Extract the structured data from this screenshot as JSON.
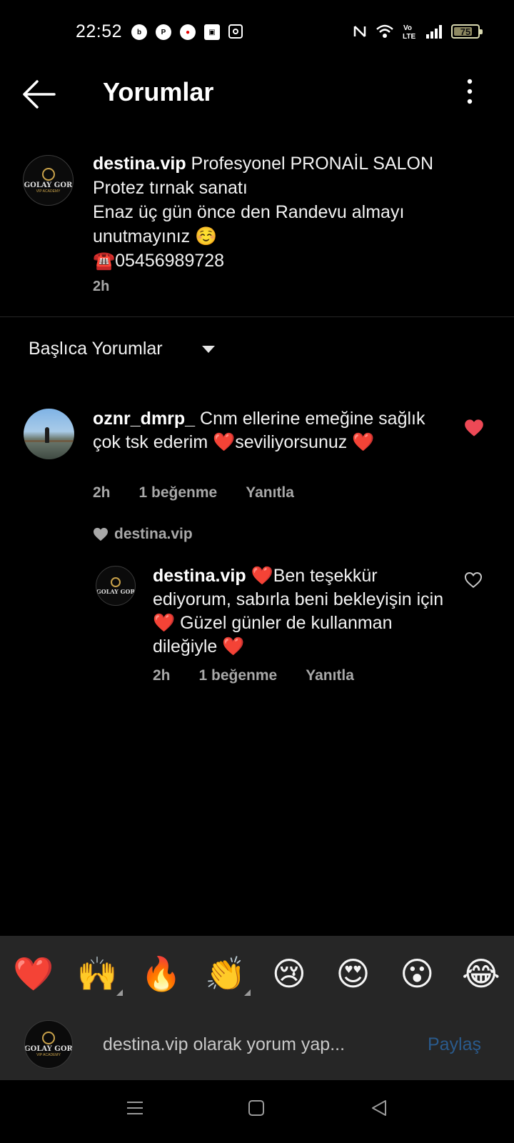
{
  "status_bar": {
    "time": "22:52",
    "app_icons": [
      "bip-icon",
      "pinterest-icon",
      "vodafone-icon",
      "box-icon",
      "instagram-icon"
    ],
    "battery": "75"
  },
  "header": {
    "title": "Yorumlar"
  },
  "caption": {
    "username": "destina.vip",
    "avatar_text": "GOLAY GOR",
    "avatar_subtext": "VIP ACADEMY",
    "line1": "Profesyonel PRONAİL SALON",
    "line2": "Protez tırnak sanatı",
    "line3": "Enaz üç gün önce den Randevu almayı",
    "line4": "unutmayınız ☺️",
    "line5": "☎️05456989728",
    "time": "2h"
  },
  "sort": {
    "label": "Başlıca Yorumlar"
  },
  "comments": [
    {
      "username": "oznr_dmrp_",
      "text_part1": "Cnm ellerine emeğine sağlık çok tsk ederim ",
      "emoji1": "❤️",
      "text_part2": "seviliyorsunuz ",
      "emoji2": "❤️",
      "time": "2h",
      "likes": "1 beğenme",
      "reply": "Yanıtla",
      "liked": true
    }
  ],
  "liked_by": "destina.vip",
  "reply": {
    "username": "destina.vip",
    "emoji1": "❤️",
    "text_part1": "Ben teşekkür ediyorum, sabırla beni bekleyişin için",
    "emoji2": "❤️",
    "text_part2": " Güzel günler de kullanman dileğiyle ",
    "emoji3": "❤️",
    "time": "2h",
    "likes": "1 beğenme",
    "reply": "Yanıtla",
    "liked": false
  },
  "emoji_bar": [
    "❤️",
    "🙌",
    "🔥",
    "👏",
    "😢",
    "😍",
    "😮",
    "😂"
  ],
  "input": {
    "placeholder": "destina.vip olarak yorum yap...",
    "share": "Paylaş"
  },
  "colors": {
    "background": "#000000",
    "surface": "#262626",
    "muted_text": "#a8a8a8",
    "like_red": "#ed4956",
    "share_blue": "#2a5a8c"
  }
}
